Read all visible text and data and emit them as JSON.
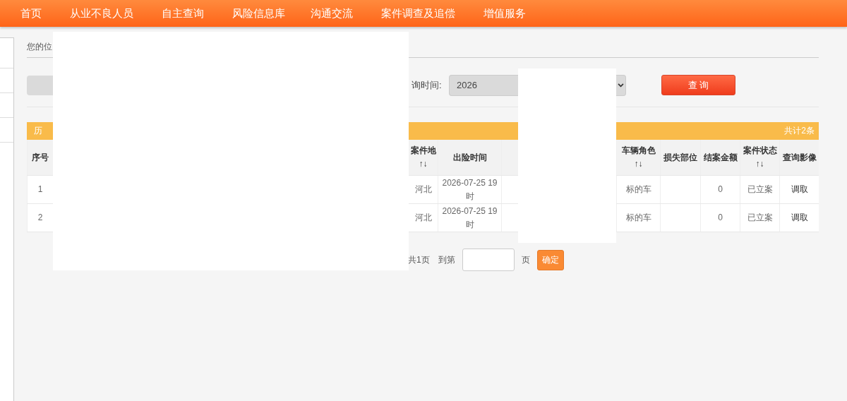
{
  "nav": {
    "items": [
      "首页",
      "从业不良人员",
      "自主查询",
      "风险信息库",
      "沟通交流",
      "案件调查及追偿",
      "增值服务"
    ]
  },
  "breadcrumb": "您的位",
  "filters": {
    "date_label": "询时间:",
    "date_value": "2026",
    "search_button": "查 询"
  },
  "panel": {
    "title": "历",
    "count": "共计2条"
  },
  "table": {
    "columns": [
      {
        "kind": "text",
        "label": "序号"
      },
      {
        "kind": "blank"
      },
      {
        "kind": "text",
        "label": "案件地↑↓"
      },
      {
        "kind": "text",
        "label": "出险时间"
      },
      {
        "kind": "blank"
      },
      {
        "kind": "text",
        "label": "车辆角色↑↓"
      },
      {
        "kind": "text",
        "label": "损失部位"
      },
      {
        "kind": "text",
        "label": "结案金额"
      },
      {
        "kind": "text",
        "label": "案件状态↑↓"
      },
      {
        "kind": "link",
        "label": "查询影像"
      }
    ],
    "rows": [
      {
        "cells": [
          "1",
          "",
          "河北",
          "2026-07-25 19时",
          "",
          "标的车",
          "",
          "0",
          "已立案",
          "调取"
        ]
      },
      {
        "cells": [
          "2",
          "",
          "河北",
          "2026-07-25 19时",
          "",
          "标的车",
          "",
          "0",
          "已立案",
          "调取"
        ]
      }
    ]
  },
  "pagination": {
    "total": "共1页",
    "goto_label": "到第",
    "suffix": "页",
    "confirm": "确定"
  }
}
